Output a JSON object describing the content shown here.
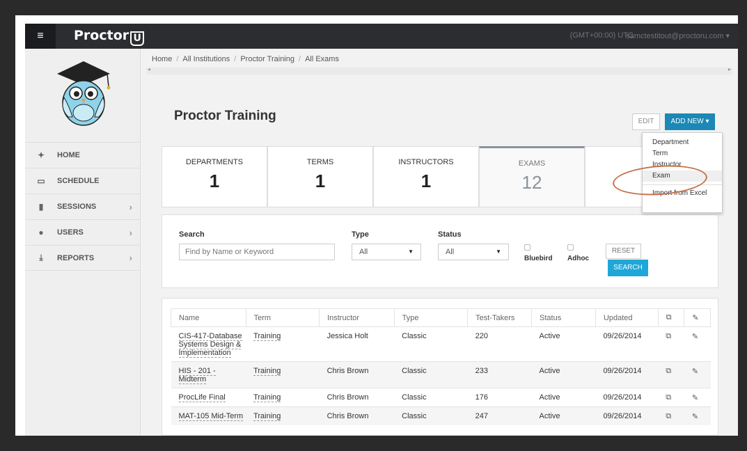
{
  "topbar": {
    "menu_icon": "hamburger-icon",
    "brand": "Proctor",
    "brand_mark": "U",
    "timezone": "(GMT+00:00) UTC",
    "user": "samctestitout@proctoru.com ▾"
  },
  "sidebar": {
    "items": [
      {
        "label": "HOME",
        "icon": "graduation-cap-icon",
        "glyph": "✦",
        "chevron": ""
      },
      {
        "label": "SCHEDULE",
        "icon": "calendar-icon",
        "glyph": "▭",
        "chevron": ""
      },
      {
        "label": "SESSIONS",
        "icon": "clipboard-icon",
        "glyph": "▮",
        "chevron": "›"
      },
      {
        "label": "USERS",
        "icon": "user-icon",
        "glyph": "●",
        "chevron": "›"
      },
      {
        "label": "REPORTS",
        "icon": "download-icon",
        "glyph": "⤓",
        "chevron": "›"
      }
    ]
  },
  "breadcrumb": {
    "items": [
      "Home",
      "All Institutions",
      "Proctor Training",
      "All Exams"
    ],
    "sep": "/"
  },
  "page": {
    "title": "Proctor Training",
    "edit_label": "EDIT",
    "add_new_label": "ADD NEW ▾"
  },
  "dropdown": {
    "options": [
      "Department",
      "Term",
      "Instructor",
      "Exam"
    ],
    "import": "Import from Excel"
  },
  "stats": [
    {
      "label": "DEPARTMENTS",
      "value": "1"
    },
    {
      "label": "TERMS",
      "value": "1"
    },
    {
      "label": "INSTRUCTORS",
      "value": "1"
    },
    {
      "label": "EXAMS",
      "value": "12"
    }
  ],
  "filters": {
    "search_label": "Search",
    "search_placeholder": "Find by Name or Keyword",
    "type_label": "Type",
    "type_value": "All",
    "status_label": "Status",
    "status_value": "All",
    "bluebird_label": "Bluebird",
    "adhoc_label": "Adhoc",
    "reset_label": "RESET",
    "search_button": "SEARCH"
  },
  "table": {
    "headers": [
      "Name",
      "Term",
      "Instructor",
      "Type",
      "Test-Takers",
      "Status",
      "Updated"
    ],
    "rows": [
      {
        "name": "CIS-417-Database Systems Design & Implementation",
        "term": "Training",
        "instructor": "Jessica Holt",
        "type": "Classic",
        "test_takers": "220",
        "status": "Active",
        "updated": "09/26/2014"
      },
      {
        "name": "HIS - 201 - Midterm",
        "term": "Training",
        "instructor": "Chris Brown",
        "type": "Classic",
        "test_takers": "233",
        "status": "Active",
        "updated": "09/26/2014"
      },
      {
        "name": "ProcLife Final",
        "term": "Training",
        "instructor": "Chris Brown",
        "type": "Classic",
        "test_takers": "176",
        "status": "Active",
        "updated": "09/26/2014"
      },
      {
        "name": "MAT-105 Mid-Term",
        "term": "Training",
        "instructor": "Chris Brown",
        "type": "Classic",
        "test_takers": "247",
        "status": "Active",
        "updated": "09/26/2014"
      }
    ]
  }
}
